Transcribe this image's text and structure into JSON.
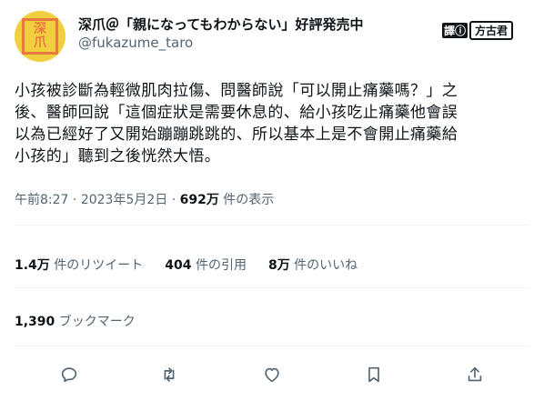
{
  "author": {
    "avatar_text": [
      "深",
      "爪"
    ],
    "display_name": "深爪＠「親になってもわからない」好評発売中",
    "handle": "@fukazume_taro"
  },
  "watermark": {
    "part1": "譯ⓘ",
    "part2": "方古君"
  },
  "tweet": {
    "lines": [
      "小孩被診斷為輕微肌肉拉傷、問醫師說「可以開止痛藥嗎？」之",
      "後、醫師回說「這個症狀是需要休息的、給小孩吃止痛藥他會誤",
      "以為已經好了又開始蹦蹦跳跳的、所以基本上是不會開止痛藥給",
      "小孩的」聽到之後恍然大悟。"
    ]
  },
  "meta": {
    "time": "午前8:27",
    "sep1": " · ",
    "date": "2023年5月2日",
    "sep2": " · ",
    "views": "692万",
    "views_label": " 件の表示"
  },
  "stats": {
    "retweets_value": "1.4万",
    "retweets_label": " 件のリツイート",
    "quotes_value": "404",
    "quotes_label": " 件の引用",
    "likes_value": "8万",
    "likes_label": " 件のいいね"
  },
  "bookmarks": {
    "value": "1,390",
    "label": " ブックマーク"
  },
  "actions": {
    "reply_icon": "reply-icon",
    "retweet_icon": "retweet-icon",
    "like_icon": "heart-icon",
    "bookmark_icon": "bookmark-icon",
    "share_icon": "share-icon"
  },
  "colors": {
    "text": "#0f1419",
    "secondary": "#536471",
    "divider": "#eff3f4",
    "avatar_bg": "#f1cf3f",
    "avatar_stamp": "#e8793f"
  }
}
